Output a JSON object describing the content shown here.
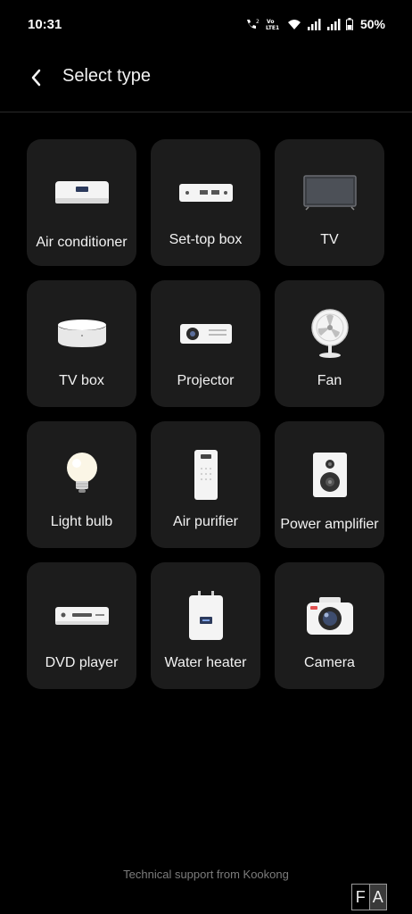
{
  "status_bar": {
    "time": "10:31",
    "battery": "50%",
    "icons": [
      "wifi-calling-icon",
      "volte-icon",
      "wifi-icon",
      "signal-icon",
      "signal-icon",
      "battery-icon"
    ],
    "volte_label": "Vo)) LTE1"
  },
  "header": {
    "title": "Select type",
    "back_icon": "chevron-left-icon"
  },
  "device_types": [
    {
      "label": "Air conditioner",
      "icon": "air-conditioner-icon"
    },
    {
      "label": "Set-top box",
      "icon": "set-top-box-icon"
    },
    {
      "label": "TV",
      "icon": "tv-icon"
    },
    {
      "label": "TV box",
      "icon": "tv-box-icon"
    },
    {
      "label": "Projector",
      "icon": "projector-icon"
    },
    {
      "label": "Fan",
      "icon": "fan-icon"
    },
    {
      "label": "Light bulb",
      "icon": "light-bulb-icon"
    },
    {
      "label": "Air purifier",
      "icon": "air-purifier-icon"
    },
    {
      "label": "Power amplifier",
      "icon": "power-amplifier-icon"
    },
    {
      "label": "DVD player",
      "icon": "dvd-player-icon"
    },
    {
      "label": "Water heater",
      "icon": "water-heater-icon"
    },
    {
      "label": "Camera",
      "icon": "camera-icon"
    }
  ],
  "footer": {
    "support_text": "Technical support from Kookong",
    "badge_left": "F",
    "badge_right": "A"
  },
  "colors": {
    "background": "#000000",
    "tile": "#1c1c1c",
    "text": "#f2f2f2",
    "muted": "#7c7c7c"
  }
}
